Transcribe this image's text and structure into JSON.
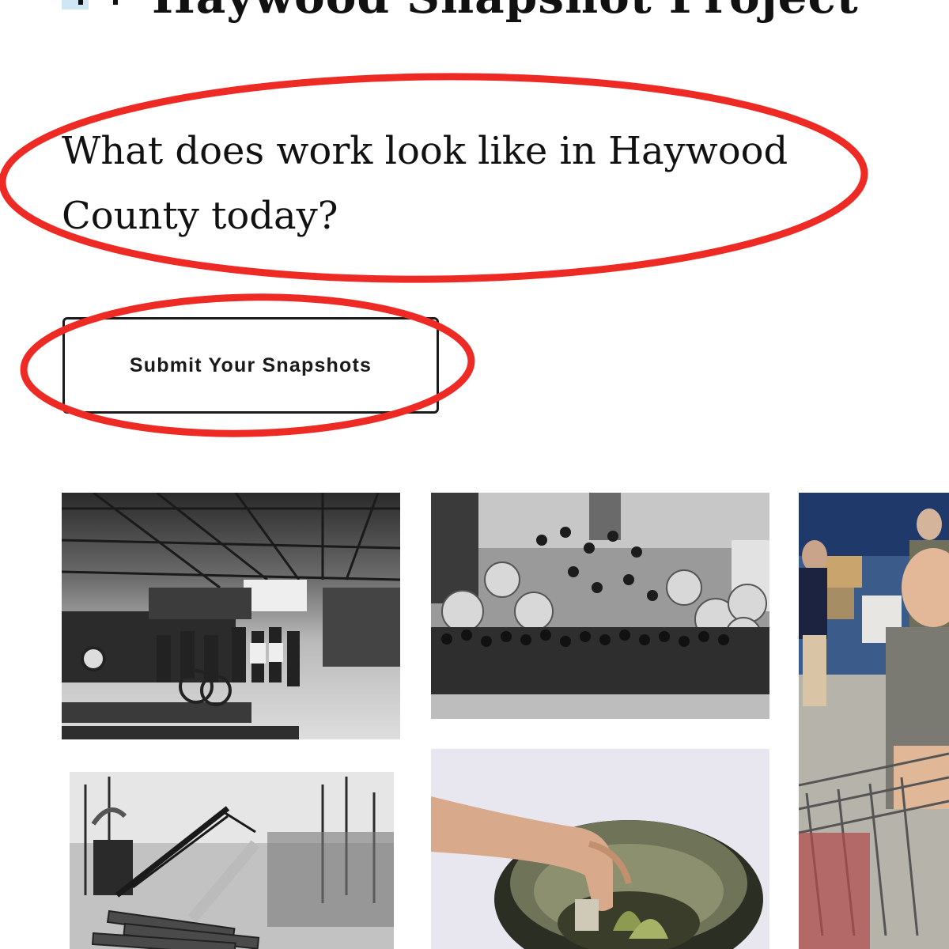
{
  "header": {
    "site_title": "Haywood Snapshot Project",
    "logo_icon": "camera-frame-icon"
  },
  "intro": {
    "heading": "What does work look like in Haywood County today?"
  },
  "cta": {
    "submit_label": "Submit Your Snapshots"
  },
  "annotations": {
    "color": "#ee2a24",
    "highlighted": [
      "intro-heading",
      "submit-button"
    ]
  },
  "gallery": {
    "photos": [
      "factory-workers-photo",
      "log-pile-crowd-photo",
      "warehouse-volunteers-photo",
      "logging-crane-photo",
      "hands-in-pot-photo"
    ]
  }
}
